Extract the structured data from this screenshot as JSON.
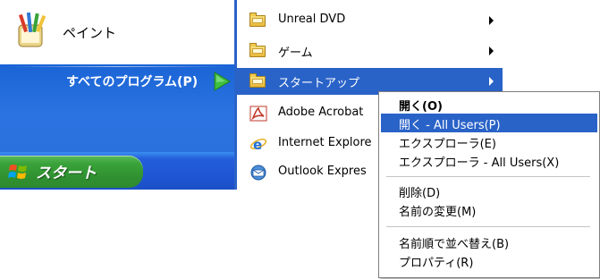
{
  "start_menu": {
    "pinned_item": {
      "label": "ペイント",
      "icon": "paint-icon"
    },
    "all_programs_label": "すべてのプログラム(P)",
    "start_button_label": "スタート"
  },
  "programs_menu": {
    "items": [
      {
        "label": "Unreal DVD",
        "icon": "folder-icon",
        "has_submenu": true
      },
      {
        "label": "ゲーム",
        "icon": "folder-icon",
        "has_submenu": true
      },
      {
        "label": "スタートアップ",
        "icon": "folder-icon",
        "has_submenu": true,
        "selected": true
      },
      {
        "label": "Adobe Acrobat",
        "icon": "adobe-acrobat-icon",
        "has_submenu": false
      },
      {
        "label": "Internet Explore",
        "icon": "internet-explorer-icon",
        "has_submenu": false
      },
      {
        "label": "Outlook Expres",
        "icon": "outlook-express-icon",
        "has_submenu": false
      }
    ]
  },
  "context_menu": {
    "items": [
      {
        "label": "開く(O)",
        "bold": true
      },
      {
        "label": "開く - All Users(P)",
        "selected": true
      },
      {
        "label": "エクスプローラ(E)"
      },
      {
        "label": "エクスプローラ - All Users(X)"
      },
      {
        "label": "削除(D)"
      },
      {
        "label": "名前の変更(M)"
      },
      {
        "label": "名前順で並べ替え(B)"
      },
      {
        "label": "プロパティ(R)"
      }
    ]
  },
  "colors": {
    "selection": "#2a63c8",
    "start_button": "#3aa33a",
    "taskbar": "#245edb"
  }
}
